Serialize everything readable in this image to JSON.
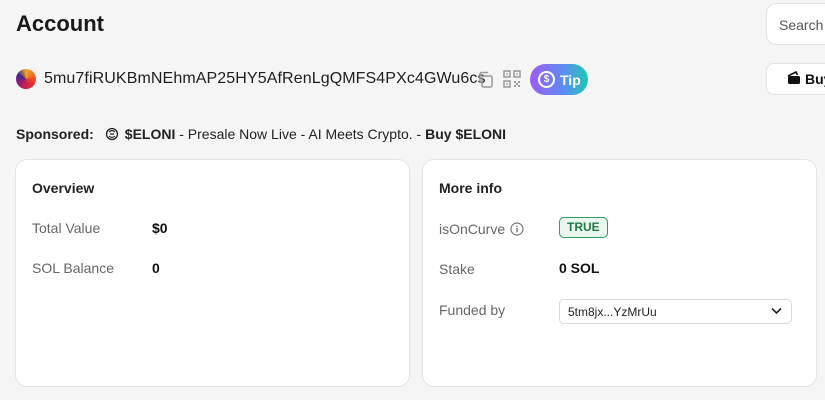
{
  "header": {
    "title": "Account",
    "search_placeholder": "Search"
  },
  "account": {
    "address": "5mu7fiRUKBmNEhmAP25HY5AfRenLgQMFS4PXc4GWu6cs",
    "tip_symbol": "$",
    "tip_label": "Tip",
    "buy_label": "Buy"
  },
  "sponsored": {
    "label": "Sponsored:",
    "token": "$ELONI",
    "text": " - Presale Now Live - AI Meets Crypto. - ",
    "cta": "Buy $ELONI"
  },
  "overview": {
    "title": "Overview",
    "rows": [
      {
        "label": "Total Value",
        "value": "$0"
      },
      {
        "label": "SOL Balance",
        "value": "0"
      }
    ]
  },
  "more_info": {
    "title": "More info",
    "is_on_curve_label": "isOnCurve",
    "is_on_curve_value": "TRUE",
    "stake_label": "Stake",
    "stake_value": "0 SOL",
    "funded_by_label": "Funded by",
    "funded_by_value": "5tm8jx...YzMrUu"
  },
  "icons": [
    "copy-icon",
    "qr-code-icon",
    "dollar-circle-icon",
    "wallet-icon",
    "eloni-token-icon",
    "info-icon",
    "chevron-down-icon"
  ],
  "colors": {
    "background": "#f5f5f5",
    "card": "#ffffff",
    "true_badge": "#2e9e5e",
    "tip_gradient_start": "#9b5cf6",
    "tip_gradient_end": "#1ec9b4"
  }
}
